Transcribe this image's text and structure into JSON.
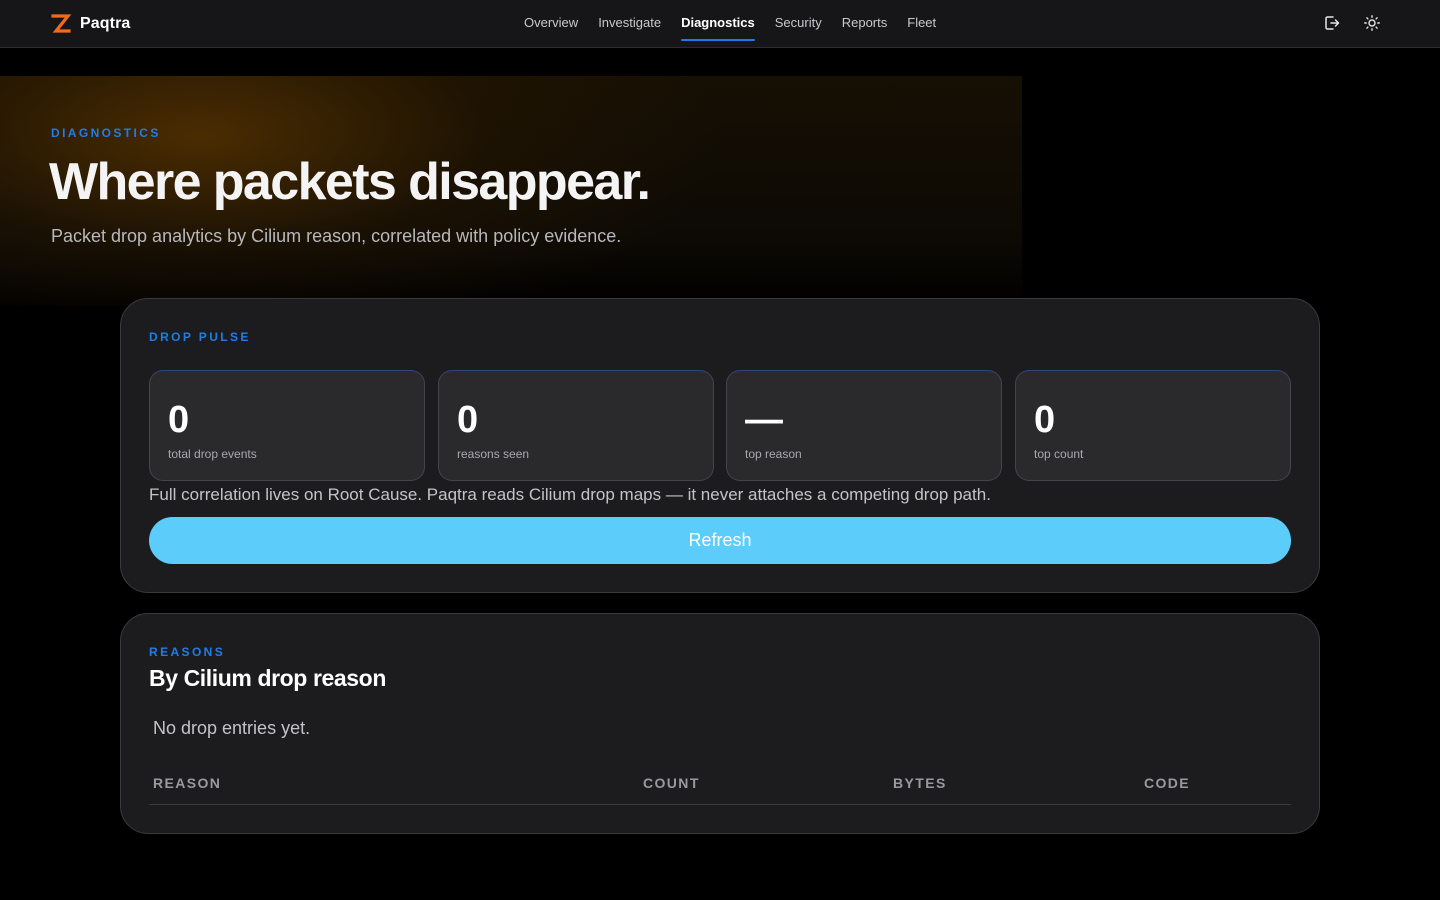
{
  "app": {
    "name": "Paqtra",
    "logo_icon": "z-logo-icon",
    "accent": "#1e7be6",
    "brand_orange": "#f26a1b"
  },
  "nav": {
    "items": [
      {
        "label": "Overview"
      },
      {
        "label": "Investigate"
      },
      {
        "label": "Diagnostics",
        "active": true
      },
      {
        "label": "Security"
      },
      {
        "label": "Reports"
      },
      {
        "label": "Fleet"
      }
    ],
    "actions": [
      "logout-icon",
      "theme-toggle-sun-icon"
    ]
  },
  "hero": {
    "eyebrow": "DIAGNOSTICS",
    "title": "Where packets disappear.",
    "subtitle": "Packet drop analytics by Cilium reason, correlated with policy evidence."
  },
  "pulse": {
    "eyebrow": "DROP PULSE",
    "stats": [
      {
        "value": "0",
        "label": "total drop events"
      },
      {
        "value": "0",
        "label": "reasons seen"
      },
      {
        "value": "—",
        "label": "top reason"
      },
      {
        "value": "0",
        "label": "top count"
      }
    ],
    "note": "Full correlation lives on Root Cause. Paqtra reads Cilium drop maps — it never attaches a competing drop path.",
    "refresh_label": "Refresh",
    "refresh_color": "#5ccdfb"
  },
  "reasons": {
    "eyebrow": "REASONS",
    "title": "By Cilium drop reason",
    "empty_message": "No drop entries yet.",
    "columns": [
      "REASON",
      "COUNT",
      "BYTES",
      "CODE"
    ],
    "rows": []
  }
}
